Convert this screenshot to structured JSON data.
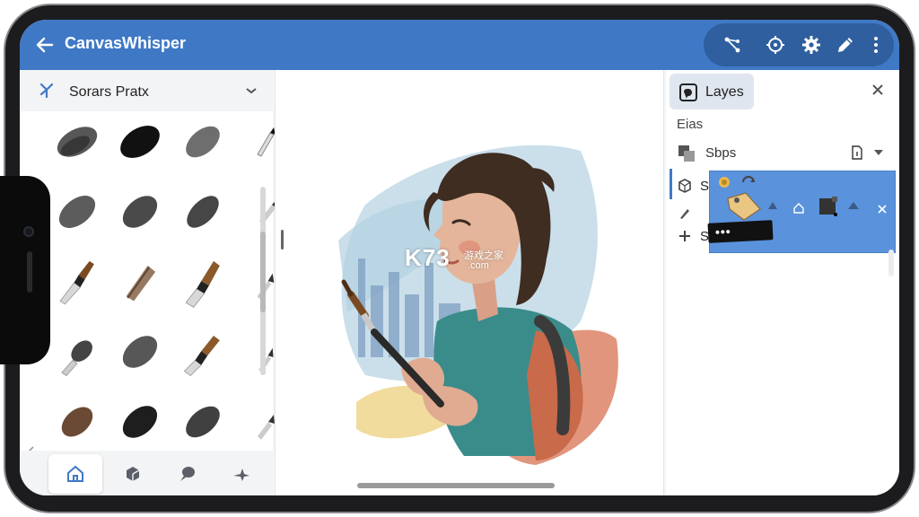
{
  "app": {
    "title": "CanvasWhisper",
    "accent_color": "#3f79c6",
    "toolbar_icons": [
      "connect-nodes-icon",
      "target-icon",
      "gear-icon",
      "pencil-icon",
      "more-vertical-icon"
    ]
  },
  "brush_panel": {
    "header_label": "Sorars Pratx",
    "header_icon": "sparkle-icon",
    "caret_icon": "chevron-down-icon",
    "brushes": [
      {
        "name": "charcoal-blob"
      },
      {
        "name": "dense-blob"
      },
      {
        "name": "soft-charcoal"
      },
      {
        "name": "pencil-tip"
      },
      {
        "name": "grain-charcoal"
      },
      {
        "name": "wet-blob"
      },
      {
        "name": "scratch-blob"
      },
      {
        "name": "pencil-tip"
      },
      {
        "name": "flat-brush-dark"
      },
      {
        "name": "fan-brush-brown"
      },
      {
        "name": "round-brush-brown"
      },
      {
        "name": "pencil-tip"
      },
      {
        "name": "dry-brush-gray"
      },
      {
        "name": "smudge-blob"
      },
      {
        "name": "filbert-brush"
      },
      {
        "name": "pencil-tip"
      },
      {
        "name": "brown-blob"
      },
      {
        "name": "ink-blob"
      },
      {
        "name": "hatch-blob"
      },
      {
        "name": "pencil-tip"
      }
    ]
  },
  "bottom_nav": {
    "items": [
      {
        "icon": "home-icon",
        "active": true
      },
      {
        "icon": "cube-icon",
        "active": false
      },
      {
        "icon": "speech-bubble-icon",
        "active": false
      },
      {
        "icon": "shapes-icon",
        "active": false
      }
    ]
  },
  "canvas": {
    "watermark_main": "K73",
    "watermark_sub": "游戏之家",
    "watermark_domain": ".com"
  },
  "layers_panel": {
    "tab_label": "Layes",
    "section_label": "Eias",
    "stack_label": "Sbps",
    "rows": [
      {
        "label": "S",
        "icon": "cube-icon"
      },
      {
        "label": "",
        "icon": "brush-icon"
      },
      {
        "label": "S",
        "icon": "plus-icon"
      }
    ],
    "popup_dots": "•••"
  }
}
